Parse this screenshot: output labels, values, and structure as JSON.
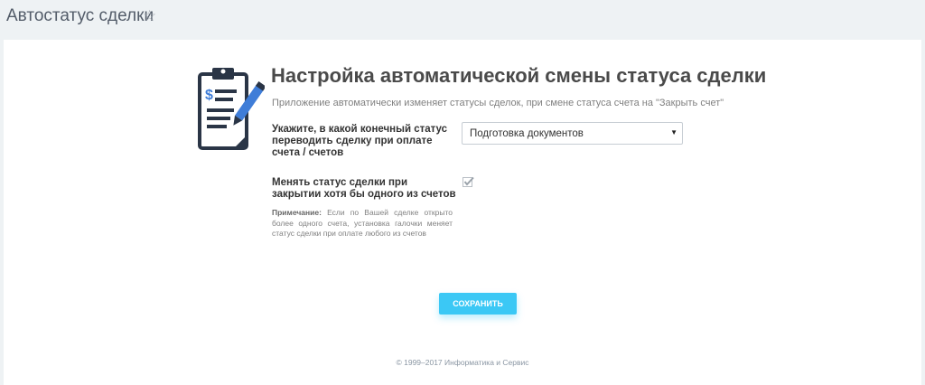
{
  "header": {
    "title": "Автостатус сделки",
    "star_icon": "star-outline-icon"
  },
  "main": {
    "title": "Настройка автоматической смены статуса сделки",
    "subtitle": "Приложение автоматически изменяет статусы сделок, при смене статуса счета на \"Закрыть счет\"",
    "status_field": {
      "label": "Укажите, в какой конечный статус переводить сделку при оплате счета / счетов",
      "selected": "Подготовка документов"
    },
    "close_field": {
      "label": "Менять статус сделки при закрытии хотя бы одного из счетов",
      "checked": true
    },
    "note": {
      "label": "Примечание:",
      "text": "Если по Вашей сделке открыто более одного счета, установка галочки меняет статус сделки при оплате любого из счетов"
    },
    "save_label": "СОХРАНИТЬ"
  },
  "footer": {
    "text": "© 1999–2017 Информатика и Сервис"
  },
  "colors": {
    "accent": "#3bc8f5",
    "icon": "#2a3546",
    "icon_blue": "#3f7dd8"
  }
}
